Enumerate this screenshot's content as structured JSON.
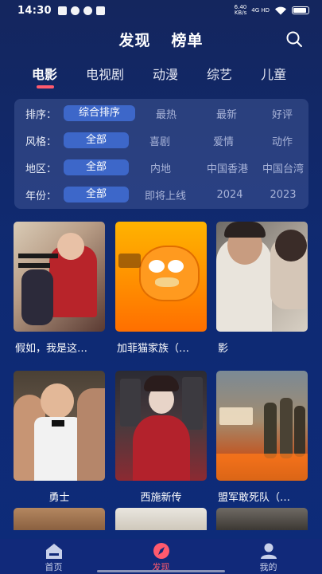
{
  "status_bar": {
    "time": "14:30",
    "speed_value": "6.40",
    "speed_unit": "KB/s",
    "network": "4G HD"
  },
  "header": {
    "tabs": [
      "发现",
      "榜单"
    ],
    "search_icon": "search-icon"
  },
  "categories": {
    "items": [
      "电影",
      "电视剧",
      "动漫",
      "综艺",
      "儿童"
    ],
    "active": "电影",
    "accent_color": "#ff5a6e"
  },
  "filters": {
    "sort": {
      "label": "排序：",
      "options": [
        "综合排序",
        "最热",
        "最新",
        "好评"
      ],
      "selected": "综合排序"
    },
    "style": {
      "label": "风格：",
      "options": [
        "全部",
        "喜剧",
        "爱情",
        "动作"
      ],
      "selected": "全部"
    },
    "region": {
      "label": "地区：",
      "options": [
        "全部",
        "内地",
        "中国香港",
        "中国台湾"
      ],
      "selected": "全部"
    },
    "year": {
      "label": "年份：",
      "options": [
        "全部",
        "即将上线",
        "2024",
        "2023"
      ],
      "selected": "全部"
    }
  },
  "movies": [
    {
      "title": "假如，我是这…"
    },
    {
      "title": "加菲猫家族（…"
    },
    {
      "title": "影"
    },
    {
      "title": "勇士"
    },
    {
      "title": "西施新传"
    },
    {
      "title": "盟军敢死队（…"
    }
  ],
  "bottom_nav": {
    "items": [
      {
        "label": "首页",
        "icon": "home-icon"
      },
      {
        "label": "发现",
        "icon": "compass-icon"
      },
      {
        "label": "我的",
        "icon": "user-icon"
      }
    ],
    "active": "发现"
  },
  "colors": {
    "background": "#14265e",
    "selected_chip": "#3d67c9",
    "nav_background": "#11297a"
  }
}
